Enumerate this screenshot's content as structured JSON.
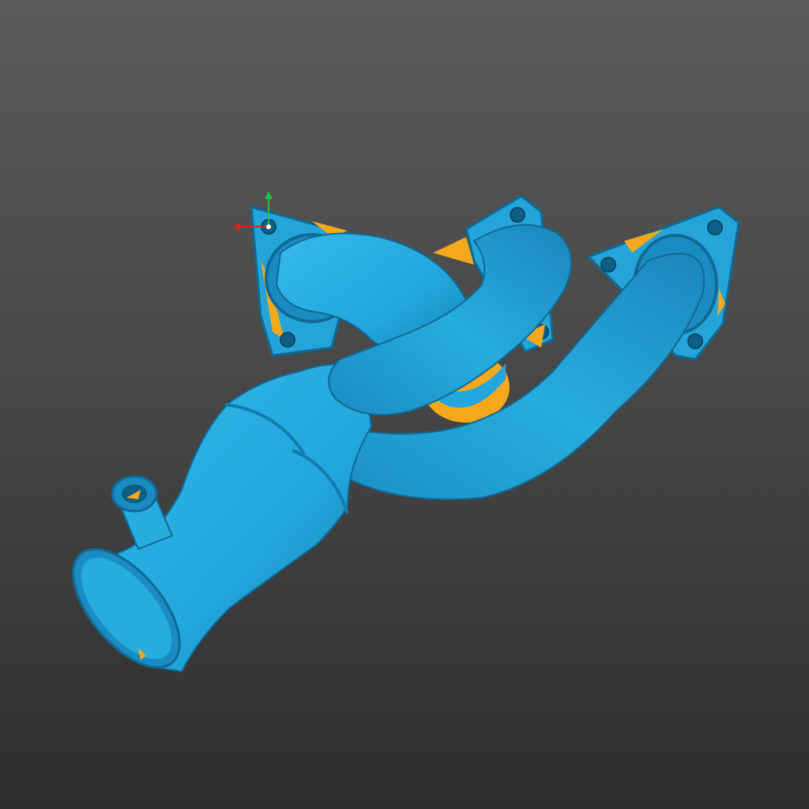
{
  "viewport": {
    "background_top": "#5a5a5a",
    "background_bottom": "#2e2e2e"
  },
  "model": {
    "name": "exhaust-manifest-scan",
    "surface_color": "#22a6dc",
    "surface_shadow": "#1479a6",
    "deviation_color": "#f4a81c"
  },
  "axis_gizmo": {
    "x_color": "#e02020",
    "y_color": "#20c040"
  }
}
